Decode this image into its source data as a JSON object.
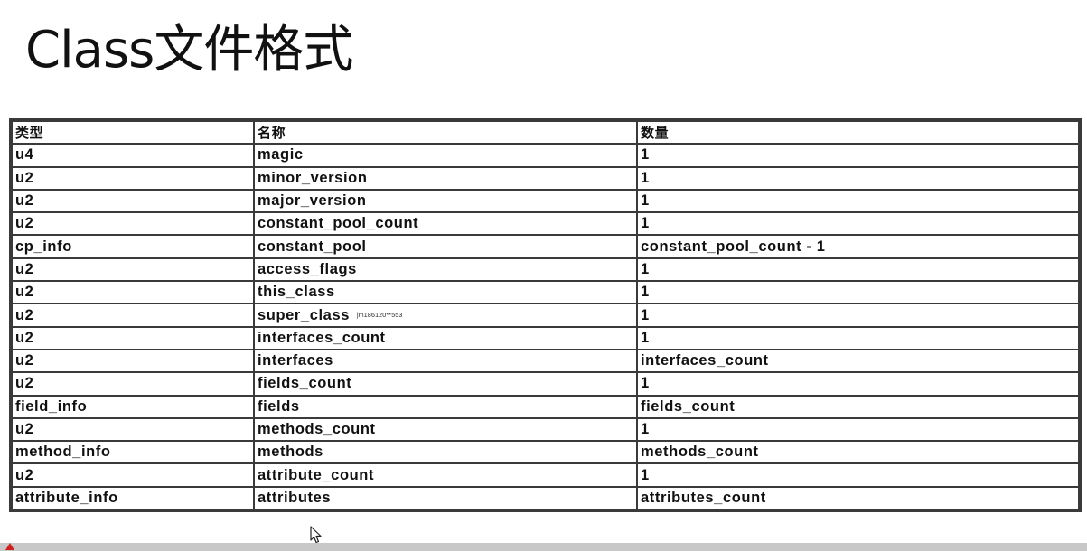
{
  "slide": {
    "title": "Class文件格式"
  },
  "table": {
    "headers": [
      "类型",
      "名称",
      "数量"
    ],
    "rows": [
      [
        "u4",
        "magic",
        "1"
      ],
      [
        "u2",
        "minor_version",
        "1"
      ],
      [
        "u2",
        "major_version",
        "1"
      ],
      [
        "u2",
        "constant_pool_count",
        "1"
      ],
      [
        "cp_info",
        "constant_pool",
        "constant_pool_count - 1"
      ],
      [
        "u2",
        "access_flags",
        "1"
      ],
      [
        "u2",
        "this_class",
        "1"
      ],
      [
        "u2",
        "super_class",
        "1"
      ],
      [
        "u2",
        "interfaces_count",
        "1"
      ],
      [
        "u2",
        "interfaces",
        "interfaces_count"
      ],
      [
        "u2",
        "fields_count",
        "1"
      ],
      [
        "field_info",
        "fields",
        "fields_count"
      ],
      [
        "u2",
        "methods_count",
        "1"
      ],
      [
        "method_info",
        "methods",
        "methods_count"
      ],
      [
        "u2",
        "attribute_count",
        "1"
      ],
      [
        "attribute_info",
        "attributes",
        "attributes_count"
      ]
    ],
    "watermark": "jm186120**553"
  },
  "icons": {
    "cursor": "mouse-pointer-icon",
    "corner": "red-triangle-icon"
  }
}
